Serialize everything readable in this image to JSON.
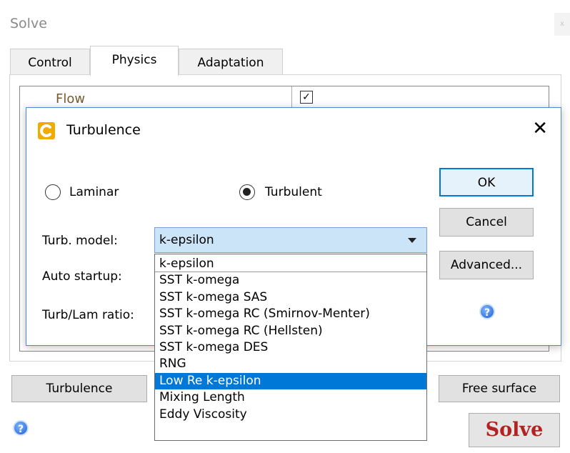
{
  "outer": {
    "title": "Solve",
    "close_glyph": "x",
    "tabs": [
      {
        "label": "Control"
      },
      {
        "label": "Physics"
      },
      {
        "label": "Adaptation"
      }
    ],
    "flow_label": "Flow",
    "flow_checked": "✓",
    "bottom_left_button": "Turbulence",
    "bottom_right_button": "Free surface",
    "solve_button": "Solve",
    "help_glyph": "?"
  },
  "dialog": {
    "title": "Turbulence",
    "close_glyph": "✕",
    "radio_laminar": "Laminar",
    "radio_turbulent": "Turbulent",
    "selected_mode": "Turbulent",
    "turb_model_label": "Turb. model:",
    "auto_startup_label": "Auto startup:",
    "turb_lam_ratio_label": "Turb/Lam ratio:",
    "ok_button": "OK",
    "cancel_button": "Cancel",
    "advanced_button": "Advanced...",
    "help_glyph": "?",
    "combo_value": "k-epsilon",
    "dropdown_options": [
      "k-epsilon",
      "SST k-omega",
      "SST k-omega SAS",
      "SST k-omega RC (Smirnov-Menter)",
      "SST k-omega RC (Hellsten)",
      "SST k-omega DES",
      "RNG",
      "Low Re k-epsilon",
      "Mixing Length",
      "Eddy Viscosity"
    ],
    "highlighted_option": "Low Re k-epsilon"
  },
  "colors": {
    "accent": "#0078d7",
    "combo_bg": "#cce4f7",
    "solve_text": "#b22222",
    "app_icon": "#f2a900"
  }
}
